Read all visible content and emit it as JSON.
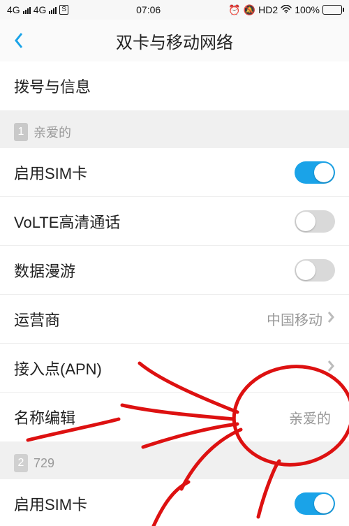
{
  "status": {
    "net1": "4G",
    "net2": "4G",
    "card_icon_label": "S",
    "time": "07:06",
    "hd_label": "HD2",
    "battery_pct": "100%",
    "battery_fill_pct": 100
  },
  "nav": {
    "title": "双卡与移动网络"
  },
  "top_items": [
    {
      "label": "拨号与信息"
    }
  ],
  "sim1": {
    "badge": "1",
    "name": "亲爱的",
    "items": {
      "enable": {
        "label": "启用SIM卡",
        "on": true
      },
      "volte": {
        "label": "VoLTE高清通话",
        "on": false
      },
      "roaming": {
        "label": "数据漫游",
        "on": false
      },
      "carrier": {
        "label": "运营商",
        "value": "中国移动"
      },
      "apn": {
        "label": "接入点(APN)"
      },
      "rename": {
        "label": "名称编辑",
        "value": "亲爱的"
      }
    }
  },
  "sim2": {
    "badge": "2",
    "name": "729",
    "items": {
      "enable": {
        "label": "启用SIM卡",
        "on": true
      }
    }
  }
}
